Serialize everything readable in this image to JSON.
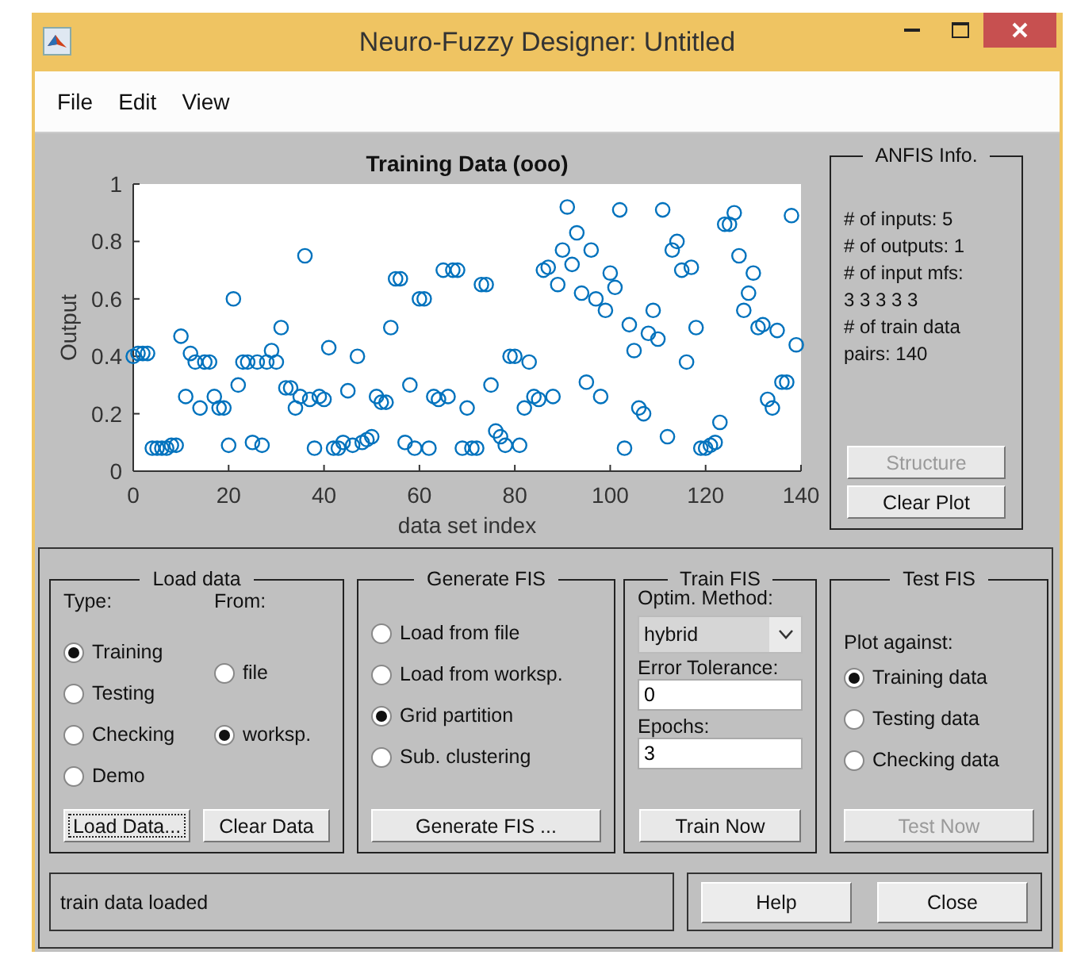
{
  "window": {
    "title": "Neuro-Fuzzy Designer: Untitled"
  },
  "menu": [
    "File",
    "Edit",
    "View"
  ],
  "plot": {
    "chart_data": {
      "type": "scatter",
      "title": "Training Data (ooo)",
      "xlabel": "data set index",
      "ylabel": "Output",
      "x": [
        0,
        1,
        2,
        3,
        4,
        5,
        6,
        7,
        8,
        9,
        10,
        11,
        12,
        13,
        14,
        15,
        16,
        17,
        18,
        19,
        20,
        21,
        22,
        23,
        24,
        25,
        26,
        27,
        28,
        29,
        30,
        31,
        32,
        33,
        34,
        35,
        36,
        37,
        38,
        39,
        40,
        41,
        42,
        43,
        44,
        45,
        46,
        47,
        48,
        49,
        50,
        51,
        52,
        53,
        54,
        55,
        56,
        57,
        58,
        59,
        60,
        61,
        62,
        63,
        64,
        65,
        66,
        67,
        68,
        69,
        70,
        71,
        72,
        73,
        74,
        75,
        76,
        77,
        78,
        79,
        80,
        81,
        82,
        83,
        84,
        85,
        86,
        87,
        88,
        89,
        90,
        91,
        92,
        93,
        94,
        95,
        96,
        97,
        98,
        99,
        100,
        101,
        102,
        103,
        104,
        105,
        106,
        107,
        108,
        109,
        110,
        111,
        112,
        113,
        114,
        115,
        116,
        117,
        118,
        119,
        120,
        121,
        122,
        123,
        124,
        125,
        126,
        127,
        128,
        129,
        130,
        131,
        132,
        133,
        134,
        135,
        136,
        137,
        138,
        139
      ],
      "series": [
        {
          "color": "#0072bd",
          "values": [
            0.4,
            0.41,
            0.41,
            0.41,
            0.08,
            0.08,
            0.08,
            0.08,
            0.09,
            0.09,
            0.47,
            0.26,
            0.41,
            0.38,
            0.22,
            0.38,
            0.38,
            0.26,
            0.22,
            0.22,
            0.09,
            0.6,
            0.3,
            0.38,
            0.38,
            0.1,
            0.38,
            0.09,
            0.38,
            0.42,
            0.38,
            0.5,
            0.29,
            0.29,
            0.22,
            0.26,
            0.75,
            0.25,
            0.08,
            0.26,
            0.25,
            0.43,
            0.08,
            0.08,
            0.1,
            0.28,
            0.09,
            0.4,
            0.1,
            0.11,
            0.12,
            0.26,
            0.24,
            0.24,
            0.5,
            0.67,
            0.67,
            0.1,
            0.3,
            0.08,
            0.6,
            0.6,
            0.08,
            0.26,
            0.25,
            0.7,
            0.26,
            0.7,
            0.7,
            0.08,
            0.22,
            0.08,
            0.08,
            0.65,
            0.65,
            0.3,
            0.14,
            0.12,
            0.09,
            0.4,
            0.4,
            0.09,
            0.22,
            0.38,
            0.26,
            0.25,
            0.7,
            0.71,
            0.26,
            0.65,
            0.77,
            0.92,
            0.72,
            0.83,
            0.62,
            0.31,
            0.77,
            0.6,
            0.26,
            0.56,
            0.69,
            0.64,
            0.91,
            0.08,
            0.51,
            0.42,
            0.22,
            0.2,
            0.48,
            0.56,
            0.46,
            0.91,
            0.12,
            0.77,
            0.8,
            0.7,
            0.38,
            0.71,
            0.5,
            0.08,
            0.08,
            0.09,
            0.1,
            0.17,
            0.86,
            0.86,
            0.9,
            0.75,
            0.56,
            0.62,
            0.69,
            0.5,
            0.51,
            0.25,
            0.22,
            0.49,
            0.31,
            0.31,
            0.89,
            0.44
          ]
        }
      ],
      "xlim": [
        0,
        140
      ],
      "ylim": [
        0,
        1
      ],
      "xticks": [
        0,
        20,
        40,
        60,
        80,
        100,
        120,
        140
      ],
      "yticks": [
        0,
        0.2,
        0.4,
        0.6,
        0.8,
        1
      ]
    }
  },
  "anfis_info": {
    "title": "ANFIS Info.",
    "lines": [
      "# of inputs: 5",
      "# of outputs: 1",
      "# of input mfs:",
      "3 3 3 3 3",
      "# of train data",
      "pairs: 140"
    ],
    "buttons": [
      {
        "label": "Structure",
        "disabled": true
      },
      {
        "label": "Clear Plot",
        "disabled": false
      }
    ]
  },
  "load_data": {
    "title": "Load data",
    "type_label": "Type:",
    "types": [
      {
        "label": "Training",
        "selected": true
      },
      {
        "label": "Testing",
        "selected": false
      },
      {
        "label": "Checking",
        "selected": false
      },
      {
        "label": "Demo",
        "selected": false
      }
    ],
    "from_label": "From:",
    "sources": [
      {
        "label": "file",
        "selected": false
      },
      {
        "label": "worksp.",
        "selected": true
      }
    ],
    "buttons": [
      {
        "label": "Load Data...",
        "disabled": false,
        "focused": true
      },
      {
        "label": "Clear Data",
        "disabled": false,
        "focused": false
      }
    ]
  },
  "generate_fis": {
    "title": "Generate FIS",
    "options": [
      {
        "label": "Load from file",
        "selected": false
      },
      {
        "label": "Load from worksp.",
        "selected": false
      },
      {
        "label": "Grid partition",
        "selected": true
      },
      {
        "label": "Sub. clustering",
        "selected": false
      }
    ],
    "button": {
      "label": "Generate FIS ...",
      "disabled": false
    }
  },
  "train_fis": {
    "title": "Train FIS",
    "method_label": "Optim. Method:",
    "method": "hybrid",
    "tolerance_label": "Error Tolerance:",
    "tolerance": "0",
    "epochs_label": "Epochs:",
    "epochs": "3",
    "button": {
      "label": "Train Now",
      "disabled": false
    }
  },
  "test_fis": {
    "title": "Test FIS",
    "plot_label": "Plot against:",
    "options": [
      {
        "label": "Training data",
        "selected": true
      },
      {
        "label": "Testing data",
        "selected": false
      },
      {
        "label": "Checking data",
        "selected": false
      }
    ],
    "button": {
      "label": "Test Now",
      "disabled": true
    }
  },
  "status": "train data loaded",
  "buttons": [
    {
      "label": "Help"
    },
    {
      "label": "Close"
    }
  ]
}
